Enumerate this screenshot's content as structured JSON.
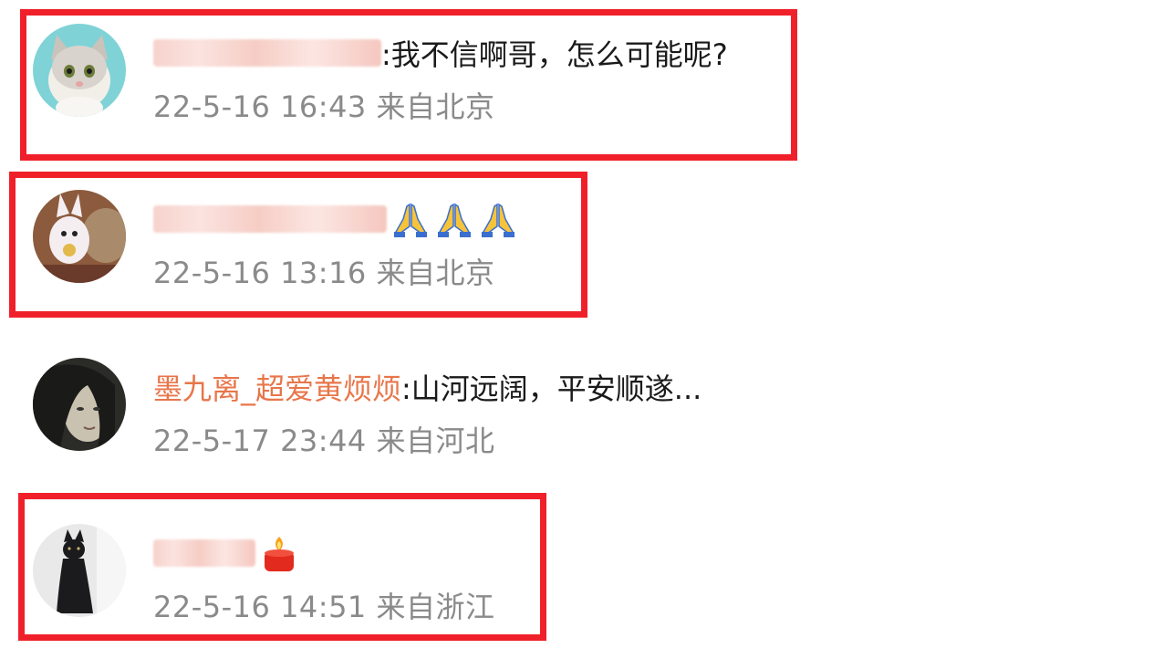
{
  "comments": [
    {
      "username": "",
      "text": ":我不信啊哥，怎么可能呢?",
      "meta": "22-5-16 16:43 来自北京",
      "highlighted": true,
      "avatar": "cat-avatar-icon"
    },
    {
      "username": "",
      "text": "",
      "emoji": [
        "folded-hands-icon",
        "folded-hands-icon",
        "folded-hands-icon"
      ],
      "meta": "22-5-16 13:16 来自北京",
      "highlighted": true,
      "avatar": "doll-avatar-icon"
    },
    {
      "username": "墨九离_超爱黄烦烦",
      "text": ":山河远阔，平安顺遂...",
      "meta": "22-5-17 23:44 来自河北",
      "highlighted": false,
      "avatar": "person-avatar-icon"
    },
    {
      "username": "",
      "text": "",
      "emoji": [
        "candle-icon"
      ],
      "meta": "22-5-16 14:51 来自浙江",
      "highlighted": true,
      "avatar": "black-cat-avatar-icon"
    }
  ],
  "colors": {
    "highlight_border": "#f0202a",
    "username": "#e8764a",
    "meta": "#8a8a8a",
    "text": "#1a1a1a"
  }
}
